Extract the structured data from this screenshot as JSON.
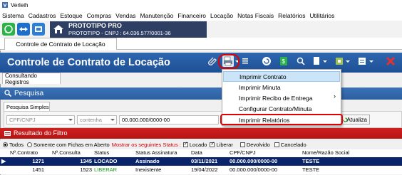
{
  "app": {
    "title": "Verleih"
  },
  "menu": [
    "Sistema",
    "Cadastros",
    "Estoque",
    "Compras",
    "Vendas",
    "Manutenção",
    "Financeiro",
    "Locação",
    "Notas Fiscais",
    "Relatórios",
    "Utilitários"
  ],
  "company": {
    "name": "PROTOTIPO PRO",
    "cnpj_line": "PROTOTIPO - CNPJ : 64.036.577/0001-36"
  },
  "tab": {
    "label": "Controle de Contrato de Locação"
  },
  "header": {
    "title": "Controle de Contrato de Locação"
  },
  "subtab": {
    "label": "Consultando Registros"
  },
  "pesquisa": {
    "label": "Pesquisa",
    "simples_tab": "Pesquisa Simples",
    "field": "CPF/CNPJ",
    "operator": "contenha",
    "value": "00.000.000/0000-00",
    "refresh_button": "Atualiza"
  },
  "resultado": {
    "label": "Resultado do Filtro"
  },
  "filters": {
    "todos": "Todos",
    "somente": "Somente com Fichas em Aberto",
    "status_label": "Mostrar os seguintes Status :",
    "locado": "Locado",
    "liberar": "Liberar",
    "devolvido": "Devolvido",
    "cancelado": "Cancelado"
  },
  "grid": {
    "columns": [
      "Nº.Contrato",
      "Nº.Consulta",
      "Status",
      "Status Assinatura",
      "Data",
      "CPF/CNPJ",
      "Nome/Razão Social"
    ],
    "rows": [
      [
        "1271",
        "1345",
        "LOCADO",
        "Assinado",
        "03/11/2021",
        "00.000.000/0000-00",
        "TESTE"
      ],
      [
        "1451",
        "1523",
        "LIBERAR",
        "Inexistente",
        "19/04/2022",
        "00.000.000/0000-00",
        "TESTE"
      ]
    ]
  },
  "popup_menu": [
    {
      "label": "Imprimir Contrato"
    },
    {
      "label": "Imprimir Minuta"
    },
    {
      "label": "Imprimir Recibo de Entrega"
    },
    {
      "label": "Configurar Contrato/Minuta"
    },
    {
      "label": "Imprimir Relatórios"
    }
  ],
  "colors": {
    "header_blue": "#2e66b0",
    "result_red": "#c51818",
    "highlight_red": "#e00000",
    "selection": "#0a246a"
  }
}
